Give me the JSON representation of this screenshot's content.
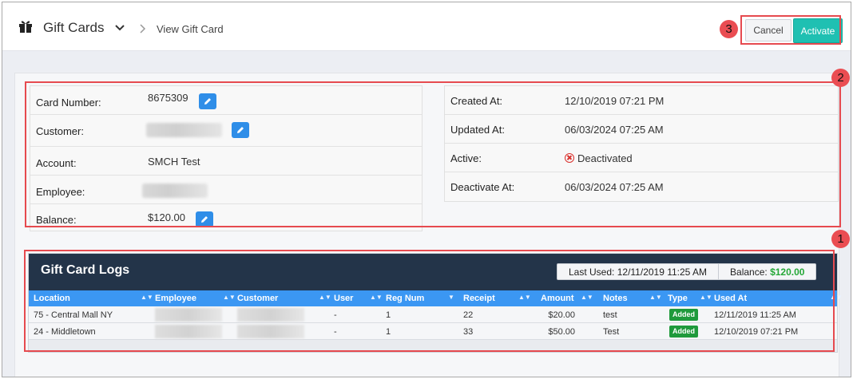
{
  "header": {
    "app_title": "Gift Cards",
    "breadcrumb_current": "View Gift Card",
    "cancel_label": "Cancel",
    "activate_label": "Activate"
  },
  "card_info": {
    "card_number_label": "Card Number:",
    "card_number": "8675309",
    "customer_label": "Customer:",
    "account_label": "Account:",
    "account": "SMCH Test",
    "employee_label": "Employee:",
    "balance_label": "Balance:",
    "balance": "$120.00"
  },
  "dates": {
    "created_label": "Created At:",
    "created": "12/10/2019 07:21 PM",
    "updated_label": "Updated At:",
    "updated": "06/03/2024 07:25 AM",
    "active_label": "Active:",
    "active": "Deactivated",
    "deactivate_label": "Deactivate At:",
    "deactivate": "06/03/2024 07:25 AM"
  },
  "logs": {
    "title": "Gift Card Logs",
    "last_used_label": "Last Used:",
    "last_used": "12/11/2019 11:25 AM",
    "balance_label": "Balance:",
    "balance": "$120.00",
    "columns": [
      "Location",
      "Employee",
      "Customer",
      "User",
      "Reg Num",
      "Receipt",
      "Amount",
      "Notes",
      "Type",
      "Used At"
    ],
    "rows": [
      {
        "location": "75 - Central Mall NY",
        "user": "-",
        "reg_num": "1",
        "receipt": "22",
        "amount": "$20.00",
        "notes": "test",
        "type": "Added",
        "used_at": "12/11/2019 11:25 AM"
      },
      {
        "location": "24 - Middletown",
        "user": "-",
        "reg_num": "1",
        "receipt": "33",
        "amount": "$50.00",
        "notes": "Test",
        "type": "Added",
        "used_at": "12/10/2019 07:21 PM"
      }
    ]
  },
  "annotations": {
    "n1": "1",
    "n2": "2",
    "n3": "3"
  },
  "colors": {
    "accent": "#1fc0b2",
    "header_dark": "#233449",
    "grid_blue": "#3b97f3",
    "annotation": "#e64a4f"
  }
}
